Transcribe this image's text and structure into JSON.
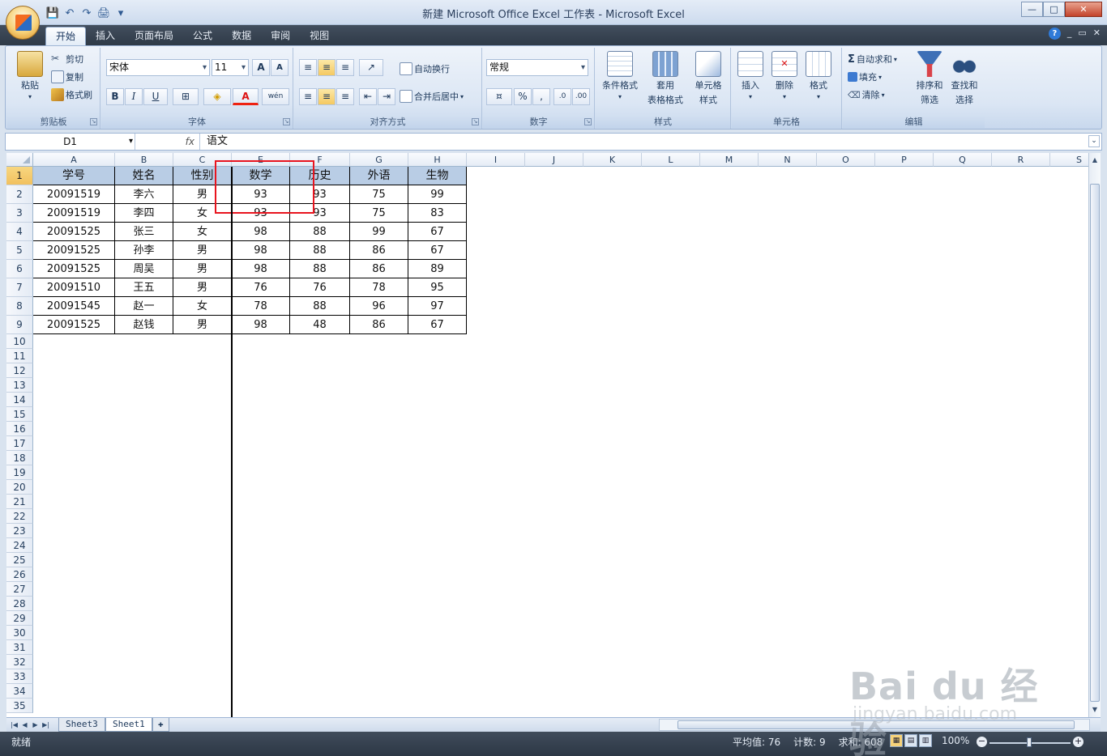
{
  "window": {
    "title": "新建 Microsoft Office Excel 工作表 - Microsoft Excel",
    "controls": {
      "minimize": "—",
      "maximize": "□",
      "close": "✕"
    }
  },
  "qat": {
    "save": "💾",
    "undo": "↶",
    "redo": "↷",
    "print": "🖨",
    "more": "▾"
  },
  "tabs": [
    "开始",
    "插入",
    "页面布局",
    "公式",
    "数据",
    "审阅",
    "视图"
  ],
  "tab_right": {
    "help": "?",
    "min": "_",
    "restore": "▭",
    "close": "✕"
  },
  "ribbon": {
    "clipboard": {
      "label": "剪贴板",
      "paste": "粘贴",
      "cut": "剪切",
      "copy": "复制",
      "format_painter": "格式刷"
    },
    "font": {
      "label": "字体",
      "font_name": "宋体",
      "font_size": "11",
      "grow": "A",
      "shrink": "A",
      "bold": "B",
      "italic": "I",
      "underline": "U",
      "phonetic": "wén"
    },
    "alignment": {
      "label": "对齐方式",
      "wrap": "自动换行",
      "merge": "合并后居中"
    },
    "number": {
      "label": "数字",
      "format": "常规",
      "percent": "%",
      "comma": ",",
      "inc_dec": ".0",
      "dec_dec": ".00"
    },
    "styles": {
      "label": "样式",
      "conditional": "条件格式",
      "table_line1": "套用",
      "table_line2": "表格格式",
      "cell_line1": "单元格",
      "cell_line2": "样式"
    },
    "cells": {
      "label": "单元格",
      "insert": "插入",
      "delete": "删除",
      "format": "格式"
    },
    "editing": {
      "label": "编辑",
      "autosum": "自动求和",
      "fill": "填充",
      "clear": "清除",
      "sort_line1": "排序和",
      "sort_line2": "筛选",
      "find_line1": "查找和",
      "find_line2": "选择"
    }
  },
  "formula_bar": {
    "name_box": "D1",
    "fx": "fx",
    "content": "语文"
  },
  "grid": {
    "columns": [
      "A",
      "B",
      "C",
      "E",
      "F",
      "G",
      "H",
      "I",
      "J",
      "K",
      "L",
      "M",
      "N",
      "O",
      "P",
      "Q",
      "R",
      "S"
    ],
    "row_numbers": [
      "1",
      "2",
      "3",
      "4",
      "5",
      "6",
      "7",
      "8",
      "9",
      "10",
      "11",
      "12",
      "13",
      "14",
      "15",
      "16",
      "17",
      "18",
      "19",
      "20",
      "21",
      "22",
      "23",
      "24",
      "25",
      "26",
      "27",
      "28",
      "29",
      "30",
      "31",
      "32",
      "33",
      "34",
      "35"
    ],
    "header": [
      "学号",
      "姓名",
      "性别",
      "数学",
      "历史",
      "外语",
      "生物"
    ],
    "rows": [
      [
        "20091519",
        "李六",
        "男",
        "93",
        "93",
        "75",
        "99"
      ],
      [
        "20091519",
        "李四",
        "女",
        "93",
        "93",
        "75",
        "83"
      ],
      [
        "20091525",
        "张三",
        "女",
        "98",
        "88",
        "99",
        "67"
      ],
      [
        "20091525",
        "孙李",
        "男",
        "98",
        "88",
        "86",
        "67"
      ],
      [
        "20091525",
        "周吴",
        "男",
        "98",
        "88",
        "86",
        "89"
      ],
      [
        "20091510",
        "王五",
        "男",
        "76",
        "76",
        "78",
        "95"
      ],
      [
        "20091545",
        "赵一",
        "女",
        "78",
        "88",
        "96",
        "97"
      ],
      [
        "20091525",
        "赵钱",
        "男",
        "98",
        "48",
        "86",
        "67"
      ]
    ]
  },
  "sheets": [
    "Sheet3",
    "Sheet1"
  ],
  "sheet_nav": [
    "|◀",
    "◀",
    "▶",
    "▶|"
  ],
  "status": {
    "ready": "就绪",
    "average": "平均值: 76",
    "count": "计数: 9",
    "sum": "求和: 608",
    "zoom": "100%",
    "zoom_minus": "−",
    "zoom_plus": "+"
  },
  "watermark": {
    "brand": "Bai du 经验",
    "url": "jingyan.baidu.com"
  },
  "colors": {
    "header_fill": "#b9cde5",
    "selection": "#f1c15f",
    "highlight_box": "#e8141e"
  }
}
